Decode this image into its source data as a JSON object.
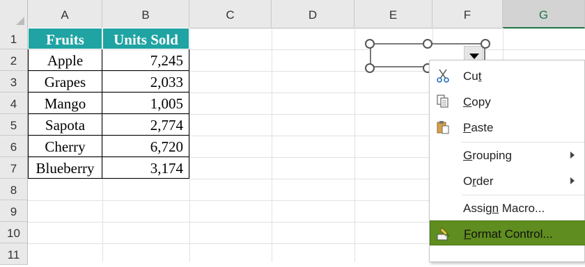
{
  "columns": [
    "A",
    "B",
    "C",
    "D",
    "E",
    "F",
    "G"
  ],
  "rows": [
    "1",
    "2",
    "3",
    "4",
    "5",
    "6",
    "7",
    "8",
    "9",
    "10",
    "11"
  ],
  "active_column": "G",
  "table": {
    "header": [
      "Fruits",
      "Units Sold"
    ],
    "header_color": "#1fa3a3",
    "rows": [
      [
        "Apple",
        "7,245"
      ],
      [
        "Grapes",
        "2,033"
      ],
      [
        "Mango",
        "1,005"
      ],
      [
        "Sapota",
        "2,774"
      ],
      [
        "Cherry",
        "6,720"
      ],
      [
        "Blueberry",
        "3,174"
      ]
    ]
  },
  "context_menu": {
    "items": [
      {
        "pre": "Cu",
        "key": "t",
        "post": "",
        "icon": "scissors-icon"
      },
      {
        "pre": "",
        "key": "C",
        "post": "opy",
        "icon": "copy-icon"
      },
      {
        "pre": "",
        "key": "P",
        "post": "aste",
        "icon": "paste-icon"
      },
      {
        "pre": "",
        "key": "G",
        "post": "rouping",
        "submenu": true
      },
      {
        "pre": "O",
        "key": "r",
        "post": "der",
        "submenu": true
      },
      {
        "pre": "Assig",
        "key": "n",
        "post": " Macro..."
      },
      {
        "pre": "",
        "key": "F",
        "post": "ormat Control...",
        "icon": "format-control-icon",
        "highlighted": true
      }
    ],
    "highlight_color": "#5f8d1f"
  }
}
